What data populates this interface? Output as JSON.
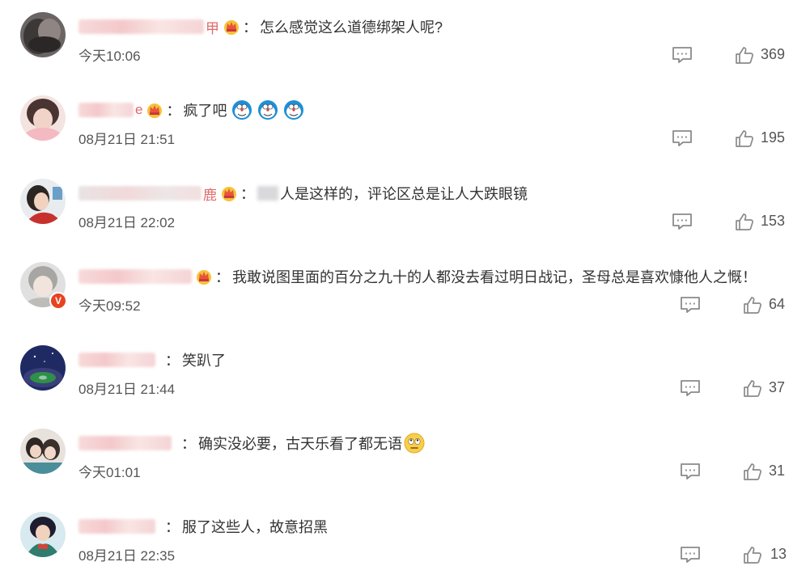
{
  "comments": [
    {
      "username_tail": "甲",
      "text": "怎么感觉这么道德绑架人呢?",
      "timestamp": "今天10:06",
      "likes": "369"
    },
    {
      "username_tail": "e",
      "text": "疯了吧",
      "emojis": [
        "doraemon-emoji",
        "doraemon-emoji",
        "doraemon-emoji"
      ],
      "timestamp": "08月21日 21:51",
      "likes": "195"
    },
    {
      "username_tail": "鹿",
      "text": "人是这样的，评论区总是让人大跌眼镜",
      "timestamp": "08月21日 22:02",
      "likes": "153"
    },
    {
      "username_tail": "",
      "text": "我敢说图里面的百分之九十的人都没去看过明日战记，圣母总是喜欢慷他人之慨！",
      "timestamp": "今天09:52",
      "likes": "64",
      "verified_badge": "V"
    },
    {
      "username_tail": "",
      "text": "笑趴了",
      "timestamp": "08月21日 21:44",
      "likes": "37"
    },
    {
      "username_tail": "",
      "text": "确实没必要，古天乐看了都无语",
      "emojis": [
        "speechless-emoji"
      ],
      "timestamp": "今天01:01",
      "likes": "31"
    },
    {
      "username_tail": "",
      "text": "服了这些人，故意招黑",
      "timestamp": "08月21日 22:35",
      "likes": "13"
    }
  ],
  "separator": "：",
  "colors": {
    "text": "#333333",
    "meta": "#555555",
    "icon": "#8a8a8a",
    "crown": "#f5b21b",
    "badge": "#e8421f"
  }
}
